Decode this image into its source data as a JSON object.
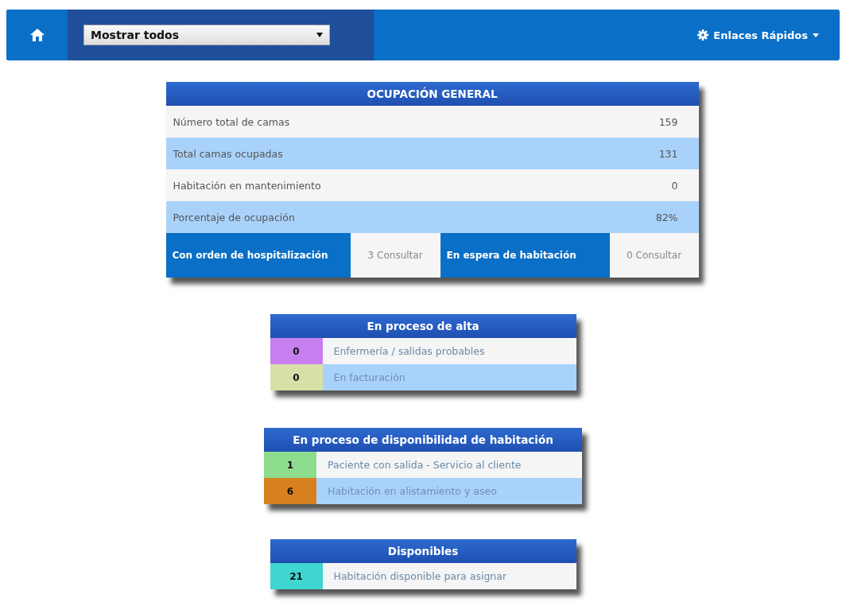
{
  "navbar": {
    "filter_select": {
      "value": "Mostrar todos"
    },
    "quick_links": {
      "label": "Enlaces Rápidos"
    }
  },
  "general": {
    "title": "OCUPACIÓN GENERAL",
    "rows": [
      {
        "label": "Número total de camas",
        "value": "159"
      },
      {
        "label": "Total camas ocupadas",
        "value": "131"
      },
      {
        "label": "Habitación en mantenimiento",
        "value": "0"
      },
      {
        "label": "Porcentaje de ocupación",
        "value": "82%"
      }
    ],
    "pending": [
      {
        "label": "Con orden de hospitalización",
        "count": "3",
        "link": "Consultar"
      },
      {
        "label": "En espera de habitación",
        "count": "0",
        "link": "Consultar"
      }
    ]
  },
  "groups": [
    {
      "title": "En proceso de alta",
      "rows": [
        {
          "count": "0",
          "label": "Enfermería / salidas probables",
          "color": "#c77ff0"
        },
        {
          "count": "0",
          "label": "En facturación",
          "color": "#d8e0a8"
        }
      ]
    },
    {
      "title": "En proceso de disponibilidad de habitación",
      "rows": [
        {
          "count": "1",
          "label": "Paciente con salida - Servicio al cliente",
          "color": "#8edc8e"
        },
        {
          "count": "6",
          "label": "Habitación en alistamiento y aseo",
          "color": "#d7801f"
        }
      ]
    },
    {
      "title": "Disponibles",
      "rows": [
        {
          "count": "21",
          "label": "Habitación disponible para asignar",
          "color": "#3fd6d0"
        }
      ]
    }
  ]
}
